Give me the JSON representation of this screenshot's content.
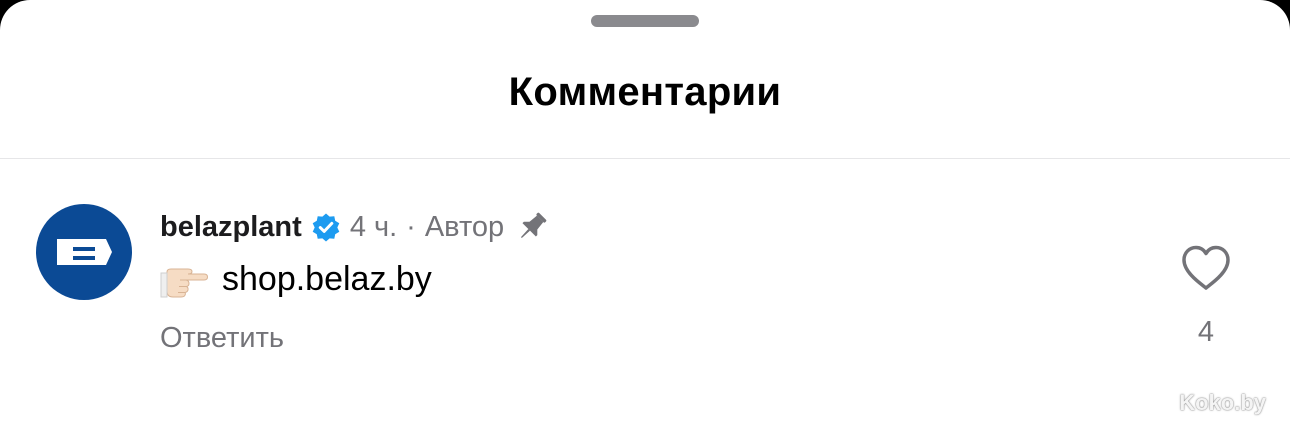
{
  "sheet": {
    "title": "Комментарии"
  },
  "comment": {
    "avatar_icon": "belaz-logo-icon",
    "username": "belazplant",
    "verified_icon": "verified-badge-icon",
    "time": "4 ч.",
    "separator": "·",
    "author_label": "Автор",
    "pin_icon": "pin-icon",
    "emoji_icon": "pointing-hand-emoji",
    "text": "shop.belaz.by",
    "reply_label": "Ответить",
    "like_icon": "heart-icon",
    "like_count": "4"
  },
  "watermark": "Koko.by",
  "colors": {
    "avatar_bg": "#0b4a95",
    "verified": "#1d9bf0",
    "secondary_text": "#737378"
  }
}
